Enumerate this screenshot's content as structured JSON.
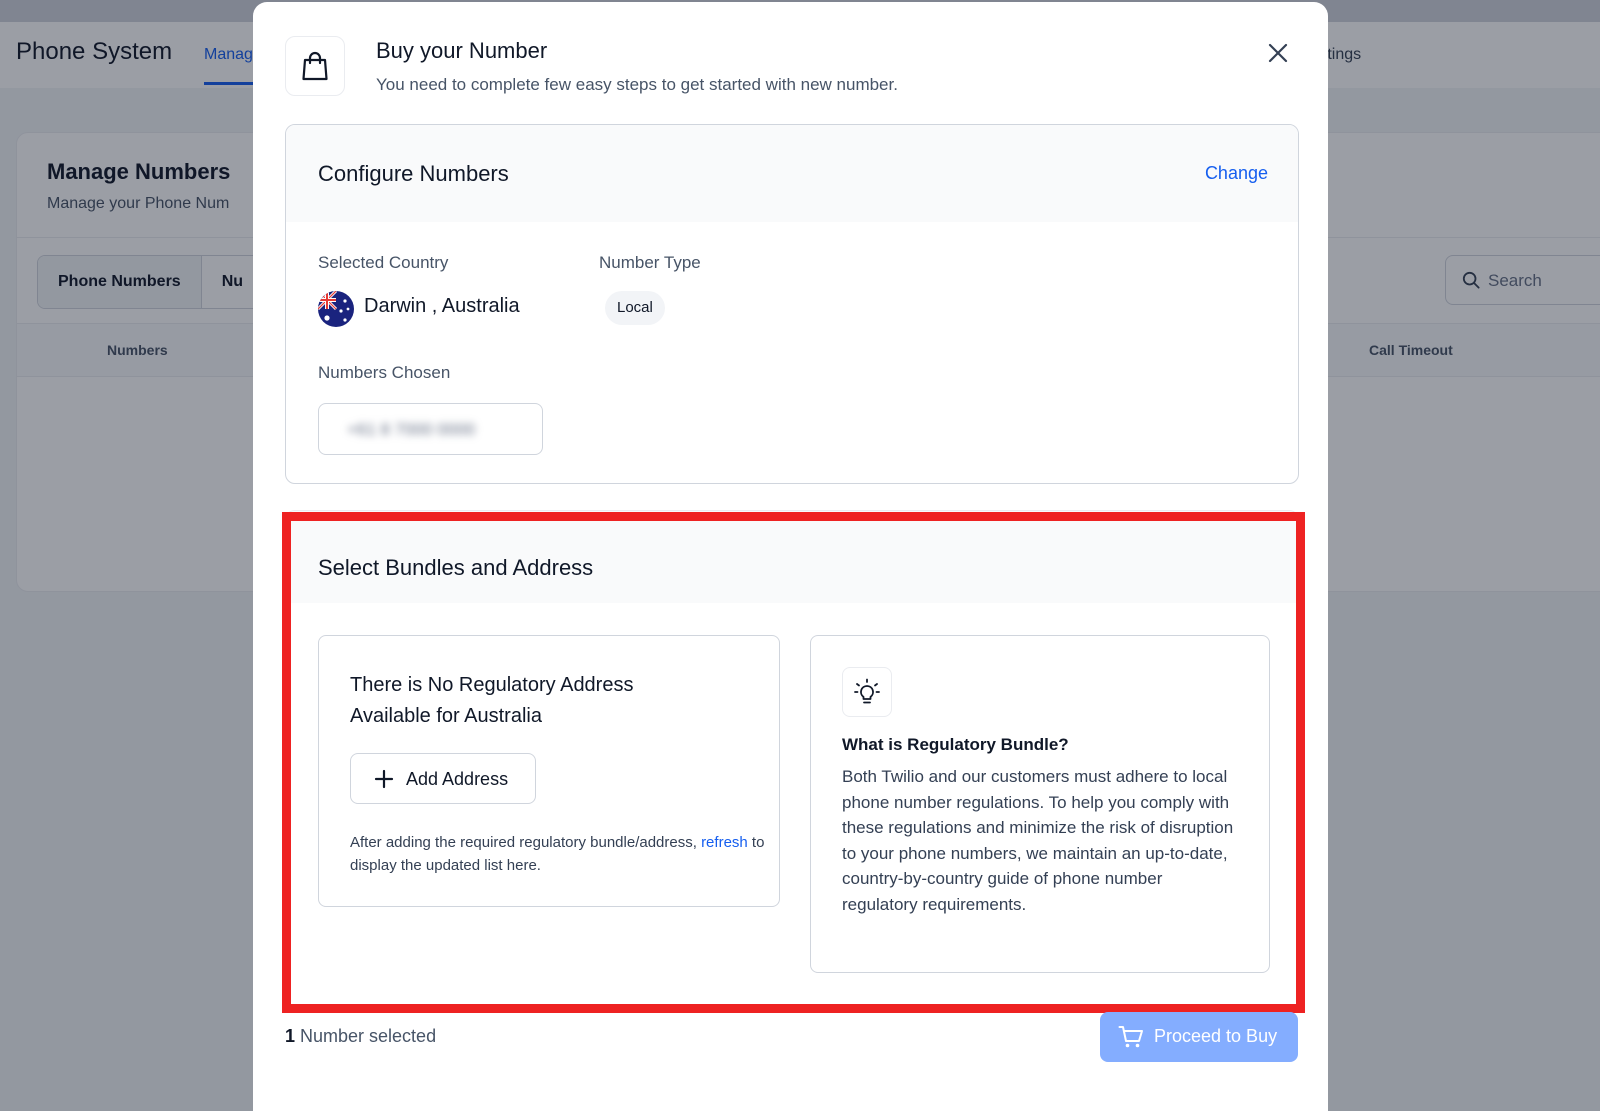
{
  "app": {
    "title": "Phone System",
    "tab_active": "Manage Numbers",
    "tab_settings": "d Settings",
    "card_title": "Manage Numbers",
    "card_subtitle": "Manage your Phone Num",
    "segment_phone_numbers": "Phone Numbers",
    "segment_second": "Nu",
    "search_placeholder": "Search",
    "col_numbers": "Numbers",
    "col_call_timeout": "Call Timeout"
  },
  "modal": {
    "title": "Buy your Number",
    "subtitle": "You need to complete few easy steps to get started with new number.",
    "configure": {
      "title": "Configure Numbers",
      "change_label": "Change",
      "country_label": "Selected Country",
      "country_value": "Darwin , Australia",
      "type_label": "Number Type",
      "type_value": "Local",
      "chosen_label": "Numbers Chosen",
      "chosen_value": "+61 8 7000 0000"
    },
    "bundles": {
      "title": "Select Bundles and Address",
      "no_address_title": "There is No Regulatory Address Available for Australia",
      "add_address_label": "Add Address",
      "note_before": "After adding the required regulatory bundle/address, ",
      "note_link": "refresh",
      "note_after": " to display the updated list here.",
      "info_title": "What is Regulatory Bundle?",
      "info_body": "Both Twilio and our customers must adhere to local phone number regulations. To help you comply with these regulations and minimize the risk of disruption to your phone numbers, we maintain an up-to-date, country-by-country guide of phone number regulatory requirements."
    },
    "footer": {
      "count": "1",
      "count_suffix": " Number selected",
      "proceed_label": "Proceed to Buy"
    }
  },
  "colors": {
    "accent": "#155eef",
    "proceed_disabled": "#84adff",
    "highlight_frame": "#ee2222"
  },
  "icons": [
    "shopping-bag-icon",
    "close-icon",
    "australia-flag-icon",
    "plus-icon",
    "lightbulb-icon",
    "cart-icon",
    "search-icon"
  ]
}
